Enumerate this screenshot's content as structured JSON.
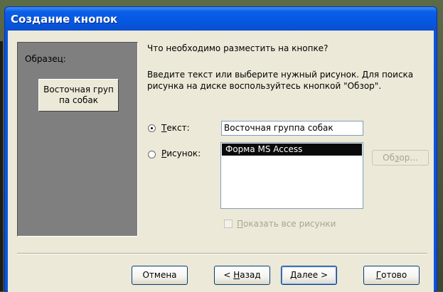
{
  "window": {
    "title": "Создание кнопок"
  },
  "preview": {
    "label": "Образец:",
    "sample_button_line1": "Восточная груп",
    "sample_button_line2": "па собак"
  },
  "content": {
    "question": "Что необходимо разместить на кнопке?",
    "instructions": "Введите текст или выберите нужный рисунок.  Для поиска рисунка на диске воспользуйтесь кнопкой \"Обзор\"."
  },
  "options": {
    "text_radio": {
      "label_underlined": "Т",
      "label_rest": "екст:",
      "checked": true
    },
    "picture_radio": {
      "label_underlined": "Р",
      "label_rest": "исунок:",
      "checked": false
    },
    "text_value": "Восточная группа собак",
    "picture_list": [
      "Форма MS Access"
    ],
    "picture_selected": "Форма MS Access",
    "browse_label_a": "Об",
    "browse_label_ul": "з",
    "browse_label_b": "ор...",
    "show_all_ul": "П",
    "show_all_rest": "оказать все рисунки"
  },
  "buttons": {
    "cancel": "Отмена",
    "back_prefix": "< ",
    "back_ul": "Н",
    "back_rest": "азад",
    "next_ul": "Д",
    "next_rest": "алее >",
    "finish_ul": "Г",
    "finish_rest": "отово"
  }
}
